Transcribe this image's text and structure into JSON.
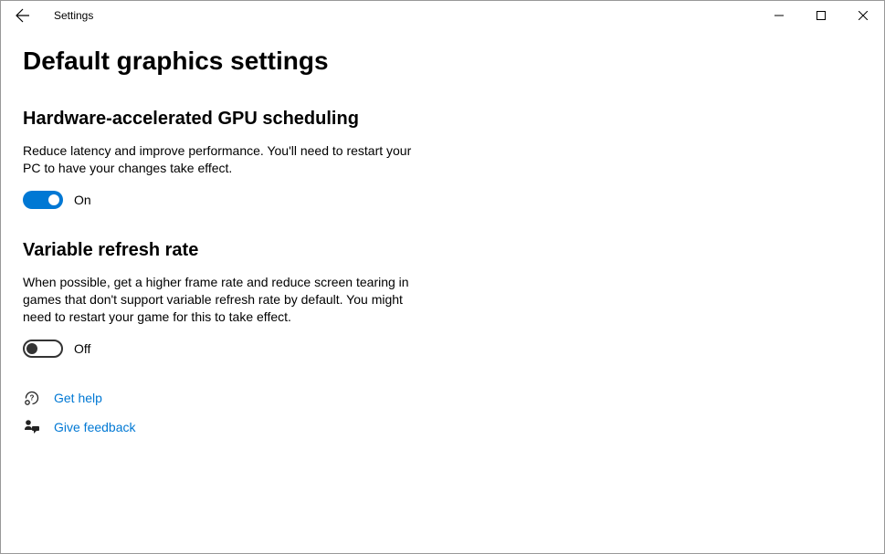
{
  "app_title": "Settings",
  "page_title": "Default graphics settings",
  "sections": {
    "hagpu": {
      "heading": "Hardware-accelerated GPU scheduling",
      "desc": "Reduce latency and improve performance. You'll need to restart your PC to have your changes take effect.",
      "toggle_state": "On"
    },
    "vrr": {
      "heading": "Variable refresh rate",
      "desc": "When possible, get a higher frame rate and reduce screen tearing in games that don't support variable refresh rate by default. You might need to restart your game for this to take effect.",
      "toggle_state": "Off"
    }
  },
  "links": {
    "get_help": "Get help",
    "give_feedback": "Give feedback"
  }
}
